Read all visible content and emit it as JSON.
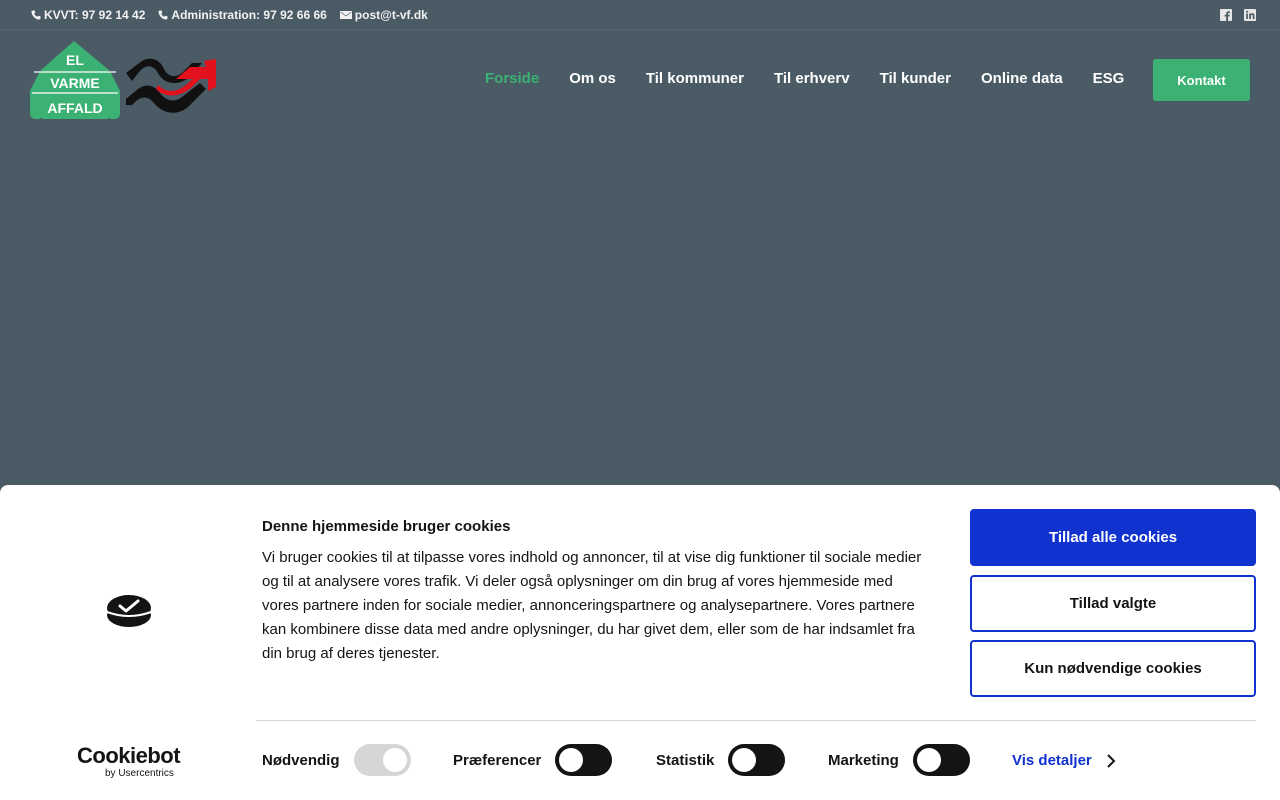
{
  "topbar": {
    "contacts": [
      {
        "icon": "phone-icon",
        "text": "KVVT: 97 92 14 42"
      },
      {
        "icon": "phone-icon",
        "text": "Administration: 97 92 66 66"
      },
      {
        "icon": "envelope-icon",
        "text": "post@t-vf.dk"
      }
    ],
    "social": [
      "facebook-icon",
      "linkedin-icon"
    ]
  },
  "logo": {
    "lines": [
      "EL",
      "VARME",
      "AFFALD"
    ],
    "colors": {
      "green": "#3bb273",
      "red": "#e3101e",
      "black": "#111111"
    }
  },
  "nav": {
    "items": [
      "Forside",
      "Om os",
      "Til kommuner",
      "Til erhverv",
      "Til kunder",
      "Online data",
      "ESG"
    ],
    "active": "Forside",
    "cta": "Kontakt"
  },
  "cookie": {
    "title": "Denne hjemmeside bruger cookies",
    "text": "Vi bruger cookies til at tilpasse vores indhold og annoncer, til at vise dig funktioner til sociale medier og til at analysere vores trafik. Vi deler også oplysninger om din brug af vores hjemmeside med vores partnere inden for sociale medier, annonceringspartnere og analysepartnere. Vores partnere kan kombinere disse data med andre oplysninger, du har givet dem, eller som de har indsamlet fra din brug af deres tjenester.",
    "buttons": {
      "allow_all": "Tillad alle cookies",
      "allow_selected": "Tillad valgte",
      "necessary_only": "Kun nødvendige cookies"
    },
    "toggles": [
      {
        "label": "Nødvendig",
        "on": true,
        "disabled": true
      },
      {
        "label": "Præferencer",
        "on": false,
        "disabled": false
      },
      {
        "label": "Statistik",
        "on": false,
        "disabled": false
      },
      {
        "label": "Marketing",
        "on": false,
        "disabled": false
      }
    ],
    "details_link": "Vis detaljer",
    "brand": {
      "name": "Cookiebot",
      "sub": "by Usercentrics"
    }
  },
  "colors": {
    "background": "#4a5b66",
    "accent_green": "#3bb273",
    "cookie_blue": "#1032cf"
  }
}
